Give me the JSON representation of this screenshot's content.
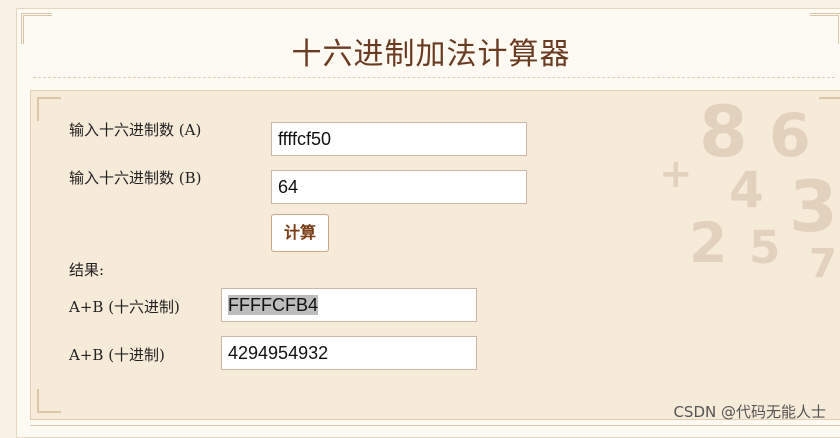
{
  "page": {
    "title": "十六进制加法计算器"
  },
  "form": {
    "input_a_label": "输入十六进制数 (A)",
    "input_a_value": "ffffcf50",
    "input_b_label": "输入十六进制数 (B)",
    "input_b_value": "64",
    "calc_button": "计算"
  },
  "result": {
    "heading": "结果:",
    "hex_label": "A+B (十六进制)",
    "hex_value": "FFFFCFB4",
    "dec_label": "A+B (十进制)",
    "dec_value": "4294954932"
  },
  "watermark": "CSDN @代码无能人士",
  "colors": {
    "title": "#6b3b21",
    "panel_bg": "#f6ead9",
    "button_text": "#7a3a12"
  }
}
